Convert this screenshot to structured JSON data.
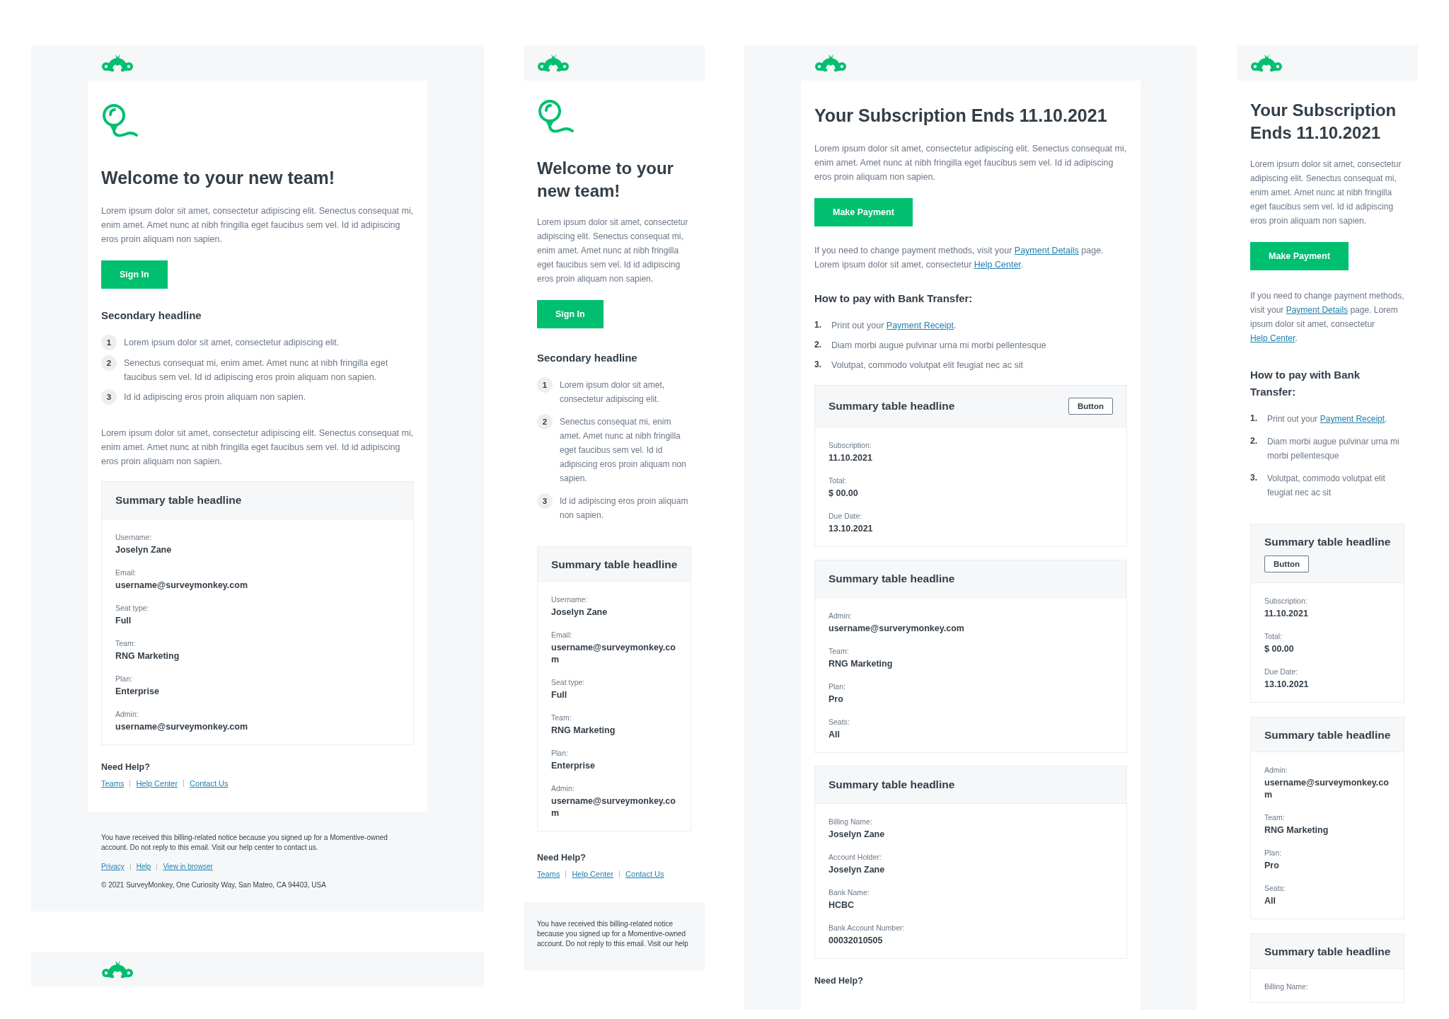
{
  "columns": [
    {
      "emails": [
        {
          "mobile": false,
          "kind": "welcome",
          "title": "Welcome to your new team!",
          "intro": "Lorem ipsum dolor sit amet, consectetur adipiscing elit. Senectus consequat mi, enim amet. Amet nunc at nibh fringilla eget faucibus sem vel. Id id adipiscing eros proin aliquam non sapien.",
          "button": "Sign In",
          "secondary_headline": "Secondary headline",
          "steps": [
            {
              "number": "1",
              "parts": [
                {
                  "text": "Lorem ipsum dolor sit amet, consectetur adipiscing elit."
                }
              ]
            },
            {
              "number": "2",
              "parts": [
                {
                  "text": "Senectus consequat mi, enim amet. Amet nunc at nibh fringilla eget faucibus sem vel. Id id adipiscing eros proin aliquam non sapien."
                }
              ]
            },
            {
              "number": "3",
              "parts": [
                {
                  "text": "Id id adipiscing eros proin aliquam non sapien."
                }
              ]
            }
          ],
          "outro": "Lorem ipsum dolor sit amet, consectetur adipiscing elit. Senectus consequat mi, enim amet. Amet nunc at nibh fringilla eget faucibus sem vel. Id id adipiscing eros proin aliquam non sapien.",
          "tables": [
            {
              "headline": "Summary table headline",
              "fields": [
                {
                  "label": "Username:",
                  "value": "Joselyn Zane"
                },
                {
                  "label": "Email:",
                  "value": "username@surveymonkey.com"
                },
                {
                  "label": "Seat type:",
                  "value": "Full"
                },
                {
                  "label": "Team:",
                  "value": "RNG Marketing"
                },
                {
                  "label": "Plan:",
                  "value": "Enterprise"
                },
                {
                  "label": "Admin:",
                  "value": "username@surveymonkey.com"
                }
              ]
            }
          ],
          "help": {
            "title": "Need Help?",
            "links": [
              "Teams",
              "Help Center",
              "Contact Us"
            ]
          },
          "footer": {
            "notice": "You have received this billing-related notice because you signed up for a Momentive-owned account. Do not reply to this email. Visit our help center to contact us.",
            "links": [
              "Privacy",
              "Help",
              "View in browser"
            ],
            "copyright": "© 2021 SurveyMonkey, One Curiosity Way, San Mateo, CA 94403, USA"
          }
        },
        {
          "mobile": false
        }
      ]
    },
    {
      "emails": [
        {
          "mobile": true,
          "kind": "welcome",
          "title": "Welcome to your new team!",
          "intro": "Lorem ipsum dolor sit amet, consectetur adipiscing elit. Senectus consequat mi, enim amet. Amet nunc at nibh fringilla eget faucibus sem vel. Id id adipiscing eros proin aliquam non sapien.",
          "button": "Sign In",
          "secondary_headline": "Secondary headline",
          "steps": [
            {
              "number": "1",
              "parts": [
                {
                  "text": "Lorem ipsum dolor sit amet, consectetur adipiscing elit."
                }
              ]
            },
            {
              "number": "2",
              "parts": [
                {
                  "text": "Senectus consequat mi, enim amet. Amet nunc at nibh fringilla eget faucibus sem vel. Id id adipiscing eros proin aliquam non sapien."
                }
              ]
            },
            {
              "number": "3",
              "parts": [
                {
                  "text": "Id id adipiscing eros proin aliquam non sapien."
                }
              ]
            }
          ],
          "tables": [
            {
              "headline": "Summary table headline",
              "fields": [
                {
                  "label": "Username:",
                  "value": "Joselyn Zane"
                },
                {
                  "label": "Email:",
                  "value": "username@surveymonkey.com"
                },
                {
                  "label": "Seat type:",
                  "value": "Full"
                },
                {
                  "label": "Team:",
                  "value": "RNG Marketing"
                },
                {
                  "label": "Plan:",
                  "value": "Enterprise"
                },
                {
                  "label": "Admin:",
                  "value": "username@surveymonkey.com"
                }
              ]
            }
          ],
          "help": {
            "title": "Need Help?",
            "links": [
              "Teams",
              "Help Center",
              "Contact Us"
            ]
          },
          "footer": {
            "notice": "You have received this billing-related notice because you signed up for a Momentive-owned account. Do not reply to this email. Visit our help"
          }
        }
      ]
    },
    {
      "emails": [
        {
          "mobile": false,
          "kind": "subscription",
          "title": "Your Subscription Ends 11.10.2021",
          "intro": "Lorem ipsum dolor sit amet, consectetur adipiscing elit. Senectus consequat mi, enim amet. Amet nunc at nibh fringilla eget faucibus sem vel. Id id adipiscing eros proin aliquam non sapien.",
          "button": "Make Payment",
          "note": [
            {
              "text": "If you need to change payment methods, visit your "
            },
            {
              "link": "Payment Details"
            },
            {
              "text": " page. Lorem ipsum dolor sit amet, consectetur "
            },
            {
              "link": "Help Center"
            },
            {
              "text": "."
            }
          ],
          "secondary_headline": "How to pay with Bank Transfer:",
          "steps": [
            {
              "number": "1.",
              "parts": [
                {
                  "text": "Print out your "
                },
                {
                  "link": "Payment Receipt"
                },
                {
                  "text": "."
                }
              ]
            },
            {
              "number": "2.",
              "parts": [
                {
                  "text": "Diam morbi augue pulvinar urna mi morbi pellentesque"
                }
              ]
            },
            {
              "number": "3.",
              "parts": [
                {
                  "text": "Volutpat, commodo volutpat elit feugiat nec ac sit"
                }
              ]
            }
          ],
          "tables": [
            {
              "headline": "Summary table headline",
              "button": "Button",
              "fields": [
                {
                  "label": "Subscription:",
                  "value": "11.10.2021"
                },
                {
                  "label": "Total:",
                  "value": "$ 00.00"
                },
                {
                  "label": "Due Date:",
                  "value": "13.10.2021"
                }
              ]
            },
            {
              "headline": "Summary table headline",
              "fields": [
                {
                  "label": "Admin:",
                  "value": "username@surverymonkey.com"
                },
                {
                  "label": "Team:",
                  "value": "RNG Marketing"
                },
                {
                  "label": "Plan:",
                  "value": "Pro"
                },
                {
                  "label": "Seats:",
                  "value": "All"
                }
              ]
            },
            {
              "headline": "Summary table headline",
              "fields": [
                {
                  "label": "Billing Name:",
                  "value": "Joselyn Zane"
                },
                {
                  "label": "Account Holder:",
                  "value": "Joselyn Zane"
                },
                {
                  "label": "Bank Name:",
                  "value": "HCBC"
                },
                {
                  "label": "Bank Account Number:",
                  "value": "00032010505"
                }
              ]
            }
          ],
          "help": {
            "title": "Need Help?"
          }
        }
      ]
    },
    {
      "emails": [
        {
          "mobile": true,
          "kind": "subscription",
          "title": "Your Subscription Ends 11.10.2021",
          "intro": "Lorem ipsum dolor sit amet, consectetur adipiscing elit. Senectus consequat mi, enim amet. Amet nunc at nibh fringilla eget faucibus sem vel. Id id adipiscing eros proin aliquam non sapien.",
          "button": "Make Payment",
          "note": [
            {
              "text": "If you need to change payment methods, visit your "
            },
            {
              "link": "Payment Details"
            },
            {
              "text": " page. Lorem ipsum dolor sit amet, consectetur "
            },
            {
              "link": "Help Center"
            },
            {
              "text": "."
            }
          ],
          "secondary_headline": "How to pay with Bank Transfer:",
          "steps": [
            {
              "number": "1.",
              "parts": [
                {
                  "text": "Print out your "
                },
                {
                  "link": "Payment Receipt"
                },
                {
                  "text": "."
                }
              ]
            },
            {
              "number": "2.",
              "parts": [
                {
                  "text": "Diam morbi augue pulvinar urna mi morbi pellentesque"
                }
              ]
            },
            {
              "number": "3.",
              "parts": [
                {
                  "text": "Volutpat, commodo volutpat elit feugiat nec ac sit"
                }
              ]
            }
          ],
          "tables": [
            {
              "headline": "Summary table headline",
              "button": "Button",
              "fields": [
                {
                  "label": "Subscription:",
                  "value": "11.10.2021"
                },
                {
                  "label": "Total:",
                  "value": "$ 00.00"
                },
                {
                  "label": "Due Date:",
                  "value": "13.10.2021"
                }
              ]
            },
            {
              "headline": "Summary table headline",
              "fields": [
                {
                  "label": "Admin:",
                  "value": "username@surveymonkey.com"
                },
                {
                  "label": "Team:",
                  "value": "RNG Marketing"
                },
                {
                  "label": "Plan:",
                  "value": "Pro"
                },
                {
                  "label": "Seats:",
                  "value": "All"
                }
              ]
            },
            {
              "headline": "Summary table headline",
              "fields": [
                {
                  "label": "Billing Name:"
                }
              ]
            }
          ]
        }
      ]
    }
  ]
}
